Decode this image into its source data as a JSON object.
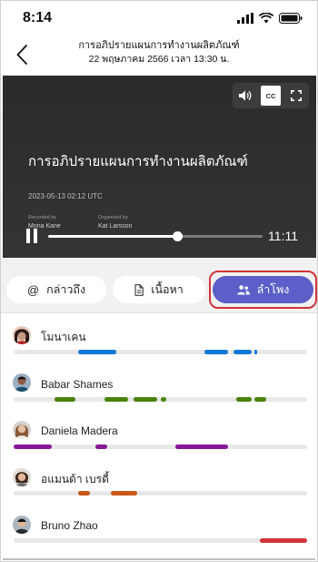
{
  "status": {
    "time": "8:14"
  },
  "header": {
    "title": "การอภิปรายแผนการทำงานผลิตภัณฑ์",
    "subtitle": "22 พฤษภาคม 2566 เวลา 13:30 น."
  },
  "video": {
    "title": "การอภิปรายแผนการทำงานผลิตภัณฑ์",
    "date": "2023-05-13 02:12 UTC",
    "recorded_by_label": "Recorded by",
    "recorded_by": "Mona Kane",
    "organized_by_label": "Organized by",
    "organized_by": "Kat Larsson",
    "time": "11:11",
    "progress": 0.6,
    "cc_label": "CC"
  },
  "tabs": [
    {
      "label": "กล่าวถึง",
      "icon": "at-icon",
      "active": false
    },
    {
      "label": "เนื้อหา",
      "icon": "document-icon",
      "active": false
    },
    {
      "label": "ลำโพง",
      "icon": "people-icon",
      "active": true
    }
  ],
  "colors": {
    "accent": "#5b5fc7",
    "highlight": "#d13438",
    "blue": "#0f78d4",
    "green": "#498205",
    "purple": "#881798",
    "orange": "#c8581a",
    "red": "#d13438"
  },
  "speakers": [
    {
      "name": "โมนาเคน",
      "color": "#0f78d4",
      "segments": [
        [
          0.22,
          0.35
        ],
        [
          0.65,
          0.73
        ],
        [
          0.75,
          0.81
        ],
        [
          0.82,
          0.83
        ]
      ]
    },
    {
      "name": "Babar Shames",
      "color": "#498205",
      "segments": [
        [
          0.14,
          0.21
        ],
        [
          0.31,
          0.39
        ],
        [
          0.41,
          0.49
        ],
        [
          0.5,
          0.52
        ],
        [
          0.76,
          0.81
        ],
        [
          0.82,
          0.86
        ]
      ]
    },
    {
      "name": "Daniela Madera",
      "color": "#881798",
      "segments": [
        [
          0.0,
          0.13
        ],
        [
          0.28,
          0.32
        ],
        [
          0.55,
          0.73
        ]
      ]
    },
    {
      "name": "อแมนด้า เบรดี้",
      "color": "#c8581a",
      "segments": [
        [
          0.22,
          0.26
        ],
        [
          0.33,
          0.42
        ]
      ]
    },
    {
      "name": "Bruno Zhao",
      "color": "#d13438",
      "segments": [
        [
          0.84,
          1.0
        ]
      ]
    }
  ]
}
